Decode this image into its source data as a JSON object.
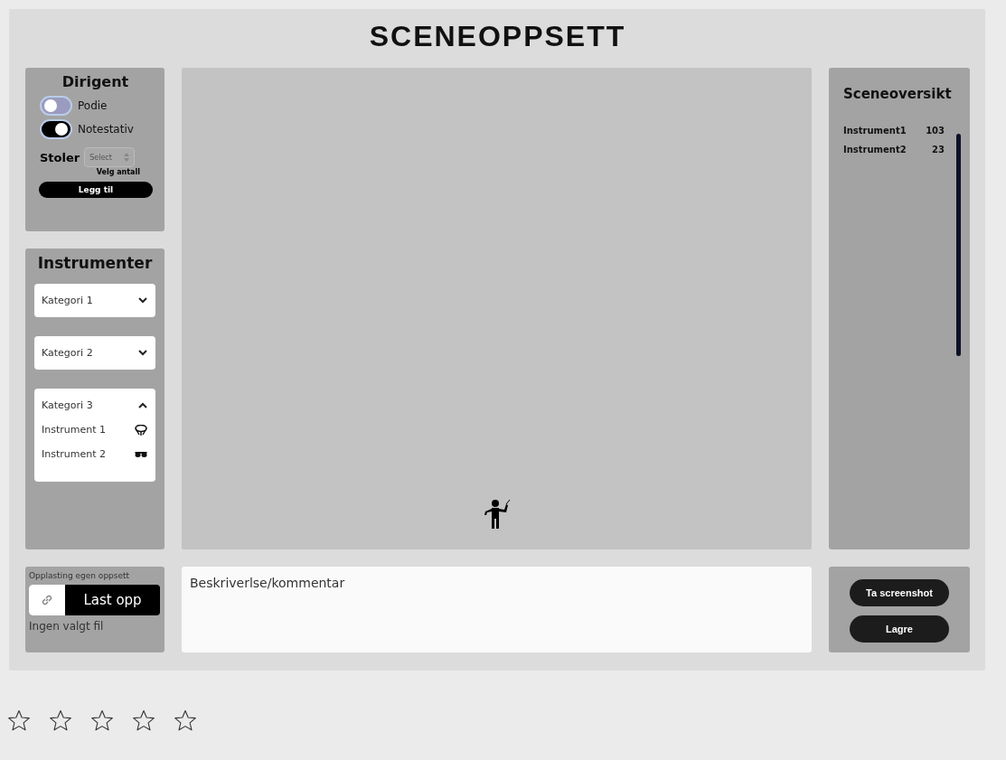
{
  "title": "SCENEOPPSETT",
  "conductor": {
    "heading": "Dirigent",
    "toggles": [
      {
        "label": "Podie",
        "on": false
      },
      {
        "label": "Notestativ",
        "on": true
      }
    ],
    "chairs_label": "Stoler",
    "chairs_select": "Select",
    "chairs_hint": "Velg antall",
    "add_button": "Legg til"
  },
  "instruments": {
    "heading": "Instrumenter",
    "categories": [
      {
        "label": "Kategori 1",
        "expanded": false
      },
      {
        "label": "Kategori 2",
        "expanded": false
      },
      {
        "label": "Kategori 3",
        "expanded": true,
        "items": [
          {
            "label": "Instrument 1"
          },
          {
            "label": "Instrument 2"
          }
        ]
      }
    ]
  },
  "overview": {
    "heading": "Sceneoversikt",
    "rows": [
      {
        "name": "Instrument1",
        "count": "103"
      },
      {
        "name": "Instrument2",
        "count": "23"
      }
    ]
  },
  "upload": {
    "label": "Opplasting egen oppsett",
    "button": "Last opp",
    "status": "Ingen valgt fil"
  },
  "comment": {
    "placeholder": "Beskriverlse/kommentar"
  },
  "actions": [
    "Ta screenshot",
    "Lagre"
  ],
  "rating": {
    "stars": 0
  }
}
